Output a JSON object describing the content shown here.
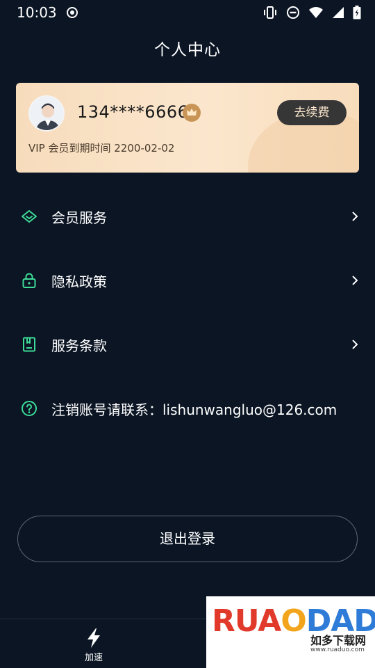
{
  "status_bar": {
    "time": "10:03"
  },
  "header": {
    "title": "个人中心"
  },
  "vip_card": {
    "phone": "134****6666",
    "renew_label": "去续费",
    "expire_text": "VIP 会员到期时间 2200-02-02"
  },
  "menu": {
    "items": [
      {
        "label": "会员服务",
        "icon": "diamond-icon"
      },
      {
        "label": "隐私政策",
        "icon": "lock-icon"
      },
      {
        "label": "服务条款",
        "icon": "document-icon"
      }
    ],
    "contact": {
      "label": "注销账号请联系：lishunwangluo@126.com",
      "icon": "help-circle-icon"
    }
  },
  "logout": {
    "label": "退出登录"
  },
  "bottom_nav": {
    "items": [
      {
        "label": "加速",
        "icon": "lightning-icon"
      }
    ]
  },
  "watermark": {
    "word": "RUANDADO",
    "sub": "如多下载网",
    "url": "www.ruaduo.com"
  },
  "colors": {
    "background": "#0b1524",
    "accent": "#3ddc97",
    "vip_gold": "#fbe6cd",
    "button_dark": "#363636"
  }
}
